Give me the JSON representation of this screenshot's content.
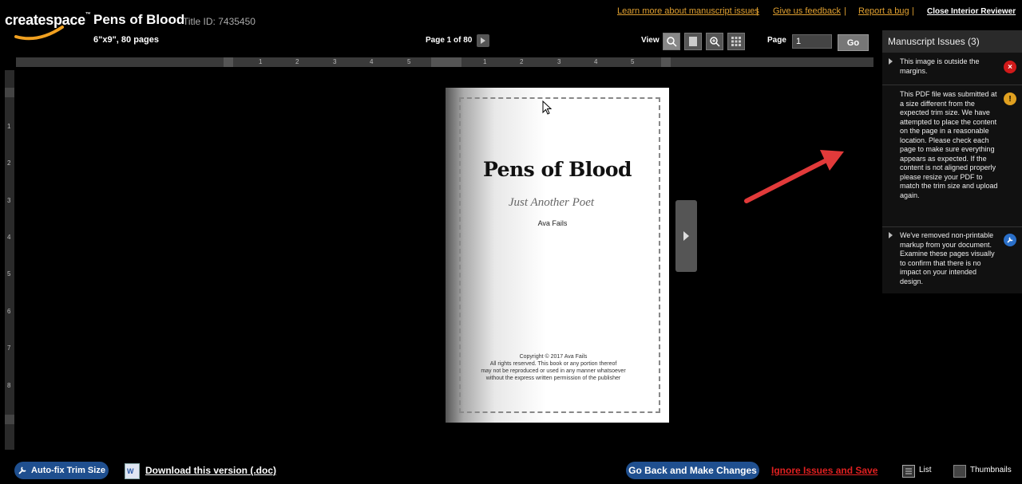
{
  "header": {
    "logo_text": "createspace",
    "logo_tm": "™",
    "book_title": "Pens of Blood",
    "title_id": "Title ID: 7435450",
    "trim_info": "6\"x9\", 80 pages",
    "page_indicator": "Page 1 of 80"
  },
  "top_links": {
    "learn_more": "Learn more about manuscript issues",
    "feedback": "Give us feedback",
    "report_bug": "Report a bug",
    "close_reviewer": "Close Interior Reviewer",
    "separator": "|"
  },
  "view_controls": {
    "view_label": "View",
    "page_label": "Page",
    "page_value": "1",
    "go_label": "Go"
  },
  "ruler": {
    "h_numbers": [
      "1",
      "2",
      "3",
      "4",
      "5",
      "1",
      "2",
      "3",
      "4",
      "5"
    ],
    "v_numbers": [
      "1",
      "2",
      "3",
      "4",
      "5",
      "6",
      "7",
      "8"
    ]
  },
  "page_preview": {
    "heading": "Pens of Blood",
    "subtitle": "Just Another Poet",
    "author": "Ava Fails",
    "copyright_lines": [
      "Copyright © 2017 Ava Fails",
      "All rights reserved. This book or any portion thereof",
      "may not be reproduced or used in any manner whatsoever",
      "without the express written permission of the publisher"
    ]
  },
  "issues_panel": {
    "title": "Manuscript Issues (3)",
    "issues": [
      {
        "text": "This image is outside the margins.",
        "icon": "error-icon"
      },
      {
        "text": "This PDF file was submitted at a size different from the expected trim size. We have attempted to place the content on the page in a reasonable location. Please check each page to make sure everything appears as expected. If the content is not aligned properly please resize your PDF to match the trim size and upload again.",
        "icon": "warning-icon"
      },
      {
        "text": "We've removed non-printable markup from your document. Examine these pages visually to confirm that there is no impact on your intended design.",
        "icon": "wrench-icon"
      }
    ]
  },
  "bottom_bar": {
    "autofix_label": "Auto-fix Trim Size",
    "download_label": "Download this version (.doc)",
    "go_back_label": "Go Back and Make Changes",
    "ignore_label": "Ignore Issues and Save",
    "list_label": "List",
    "thumbnails_label": "Thumbnails"
  },
  "colors": {
    "accent_link": "#e0a030",
    "primary_button": "#1f4f8f",
    "danger_link": "#e02020",
    "error": "#d11a1a",
    "warning": "#e0a020",
    "info": "#2a6fc9",
    "annotation_arrow": "#e23a3a"
  }
}
